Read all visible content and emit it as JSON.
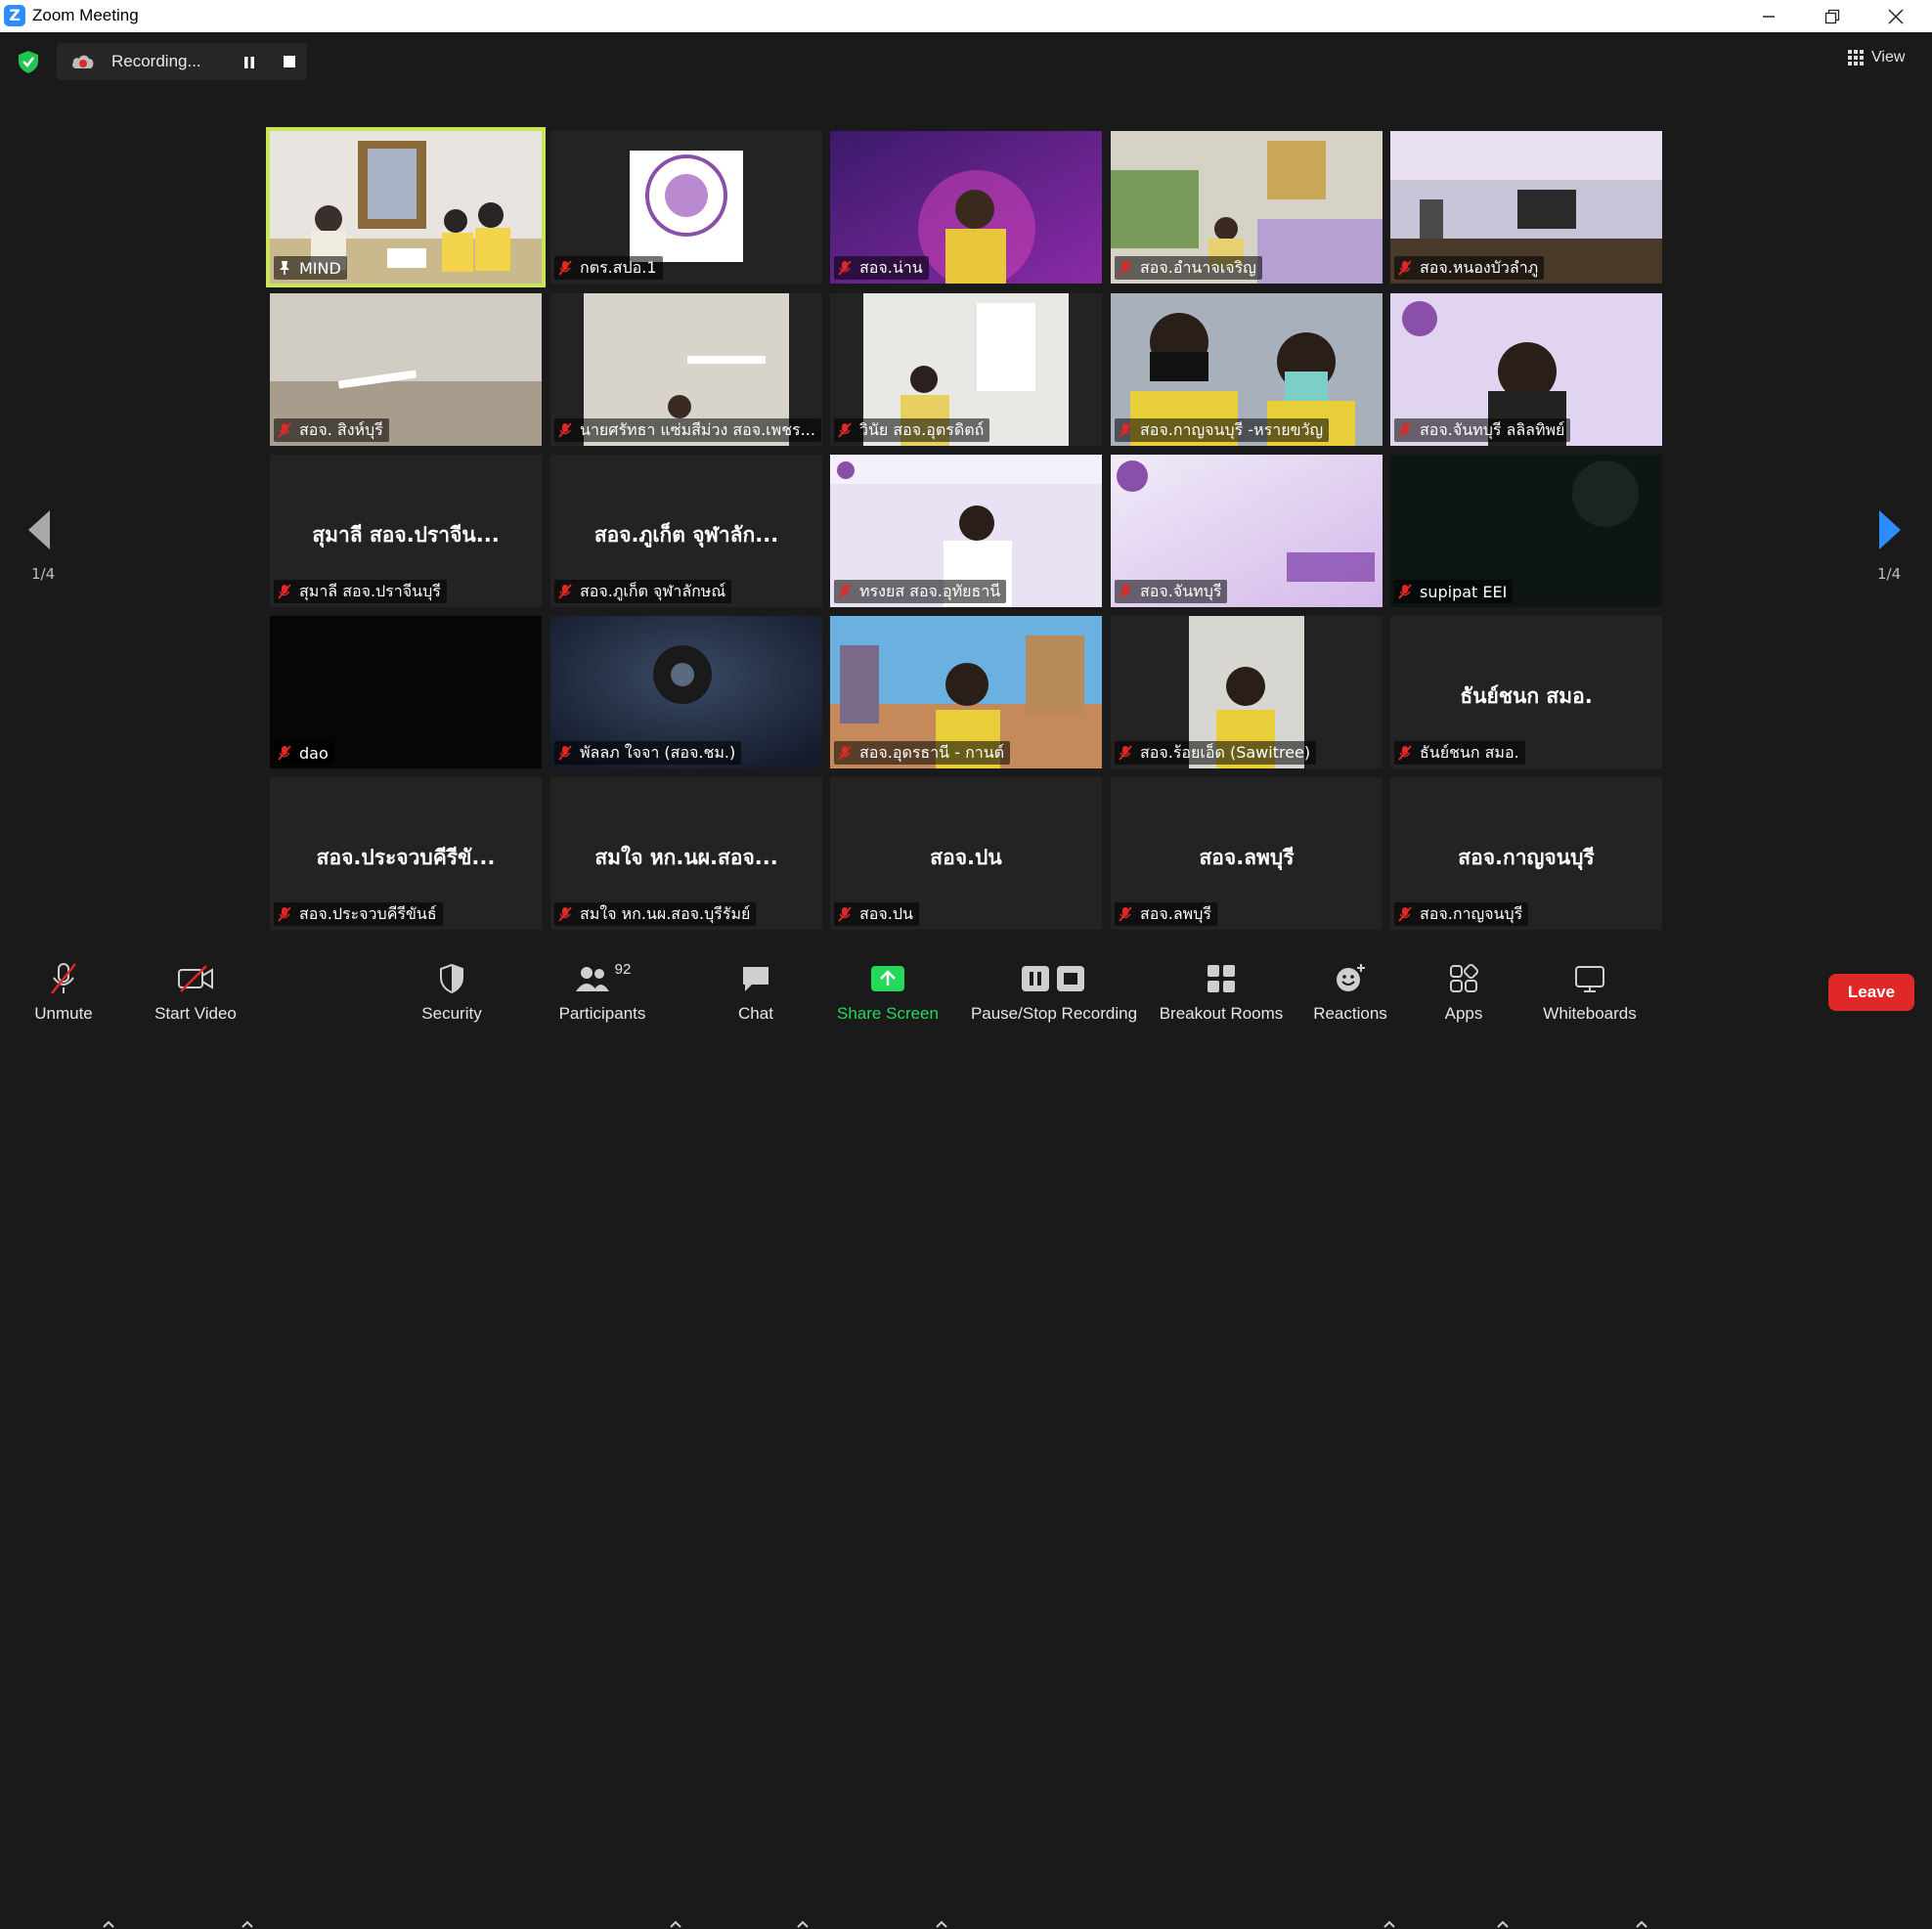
{
  "window": {
    "title": "Zoom Meeting"
  },
  "topbar": {
    "recording_label": "Recording...",
    "view_label": "View"
  },
  "pagination": {
    "left": "1/4",
    "right": "1/4"
  },
  "participants": [
    {
      "label": "MIND",
      "big": "",
      "icon": "pin-icon"
    },
    {
      "label": "กตร.สปอ.1",
      "big": ""
    },
    {
      "label": "สอจ.น่าน",
      "big": ""
    },
    {
      "label": "สอจ.อำนาจเจริญ",
      "big": ""
    },
    {
      "label": "สอจ.หนองบัวลำภู",
      "big": ""
    },
    {
      "label": "สอจ. สิงห์บุรี",
      "big": ""
    },
    {
      "label": "นายศรัทธา แซ่มสีม่วง สอจ.เพชร...",
      "big": ""
    },
    {
      "label": "วินัย สอจ.อุตรดิตถ์",
      "big": ""
    },
    {
      "label": "สอจ.กาญจนบุรี -หรายขวัญ",
      "big": ""
    },
    {
      "label": "สอจ.จันทบุรี ลลิลทิพย์",
      "big": ""
    },
    {
      "label": "สุมาลี สอจ.ปราจีนบุรี",
      "big": "สุมาลี สอจ.ปราจีน..."
    },
    {
      "label": "สอจ.ภูเก็ต จุฬาลักษณ์",
      "big": "สอจ.ภูเก็ต จุฬาลัก..."
    },
    {
      "label": "ทรงยส สอจ.อุทัยธานี",
      "big": ""
    },
    {
      "label": "สอจ.จันทบุรี",
      "big": ""
    },
    {
      "label": "supipat EEI",
      "big": ""
    },
    {
      "label": "dao",
      "big": ""
    },
    {
      "label": "พัลลภ ใจจา (สอจ.ชม.)",
      "big": ""
    },
    {
      "label": "สอจ.อุดรธานี - กานต์",
      "big": ""
    },
    {
      "label": "สอจ.ร้อยเอ็ด (Sawitree)",
      "big": ""
    },
    {
      "label": "ธันย์ชนก สมอ.",
      "big": "ธันย์ชนก สมอ."
    },
    {
      "label": "สอจ.ประจวบคีรีขันธ์",
      "big": "สอจ.ประจวบคีรีขั..."
    },
    {
      "label": "สมใจ หก.นผ.สอจ.บุรีรัมย์",
      "big": "สมใจ หก.นผ.สอจ..."
    },
    {
      "label": "สอจ.ปน",
      "big": "สอจ.ปน"
    },
    {
      "label": "สอจ.ลพบุรี",
      "big": "สอจ.ลพบุรี"
    },
    {
      "label": "สอจ.กาญจนบุรี",
      "big": "สอจ.กาญจนบุรี"
    }
  ],
  "toolbar": {
    "unmute": "Unmute",
    "start_video": "Start Video",
    "security": "Security",
    "participants": "Participants",
    "participants_count": "92",
    "chat": "Chat",
    "share_screen": "Share Screen",
    "recording": "Pause/Stop Recording",
    "breakout": "Breakout Rooms",
    "reactions": "Reactions",
    "apps": "Apps",
    "whiteboards": "Whiteboards",
    "leave": "Leave"
  },
  "colors": {
    "active_speaker": "#cbe55a",
    "share_green": "#24d85a",
    "leave_red": "#e02828",
    "accent_blue": "#2d8cff"
  }
}
